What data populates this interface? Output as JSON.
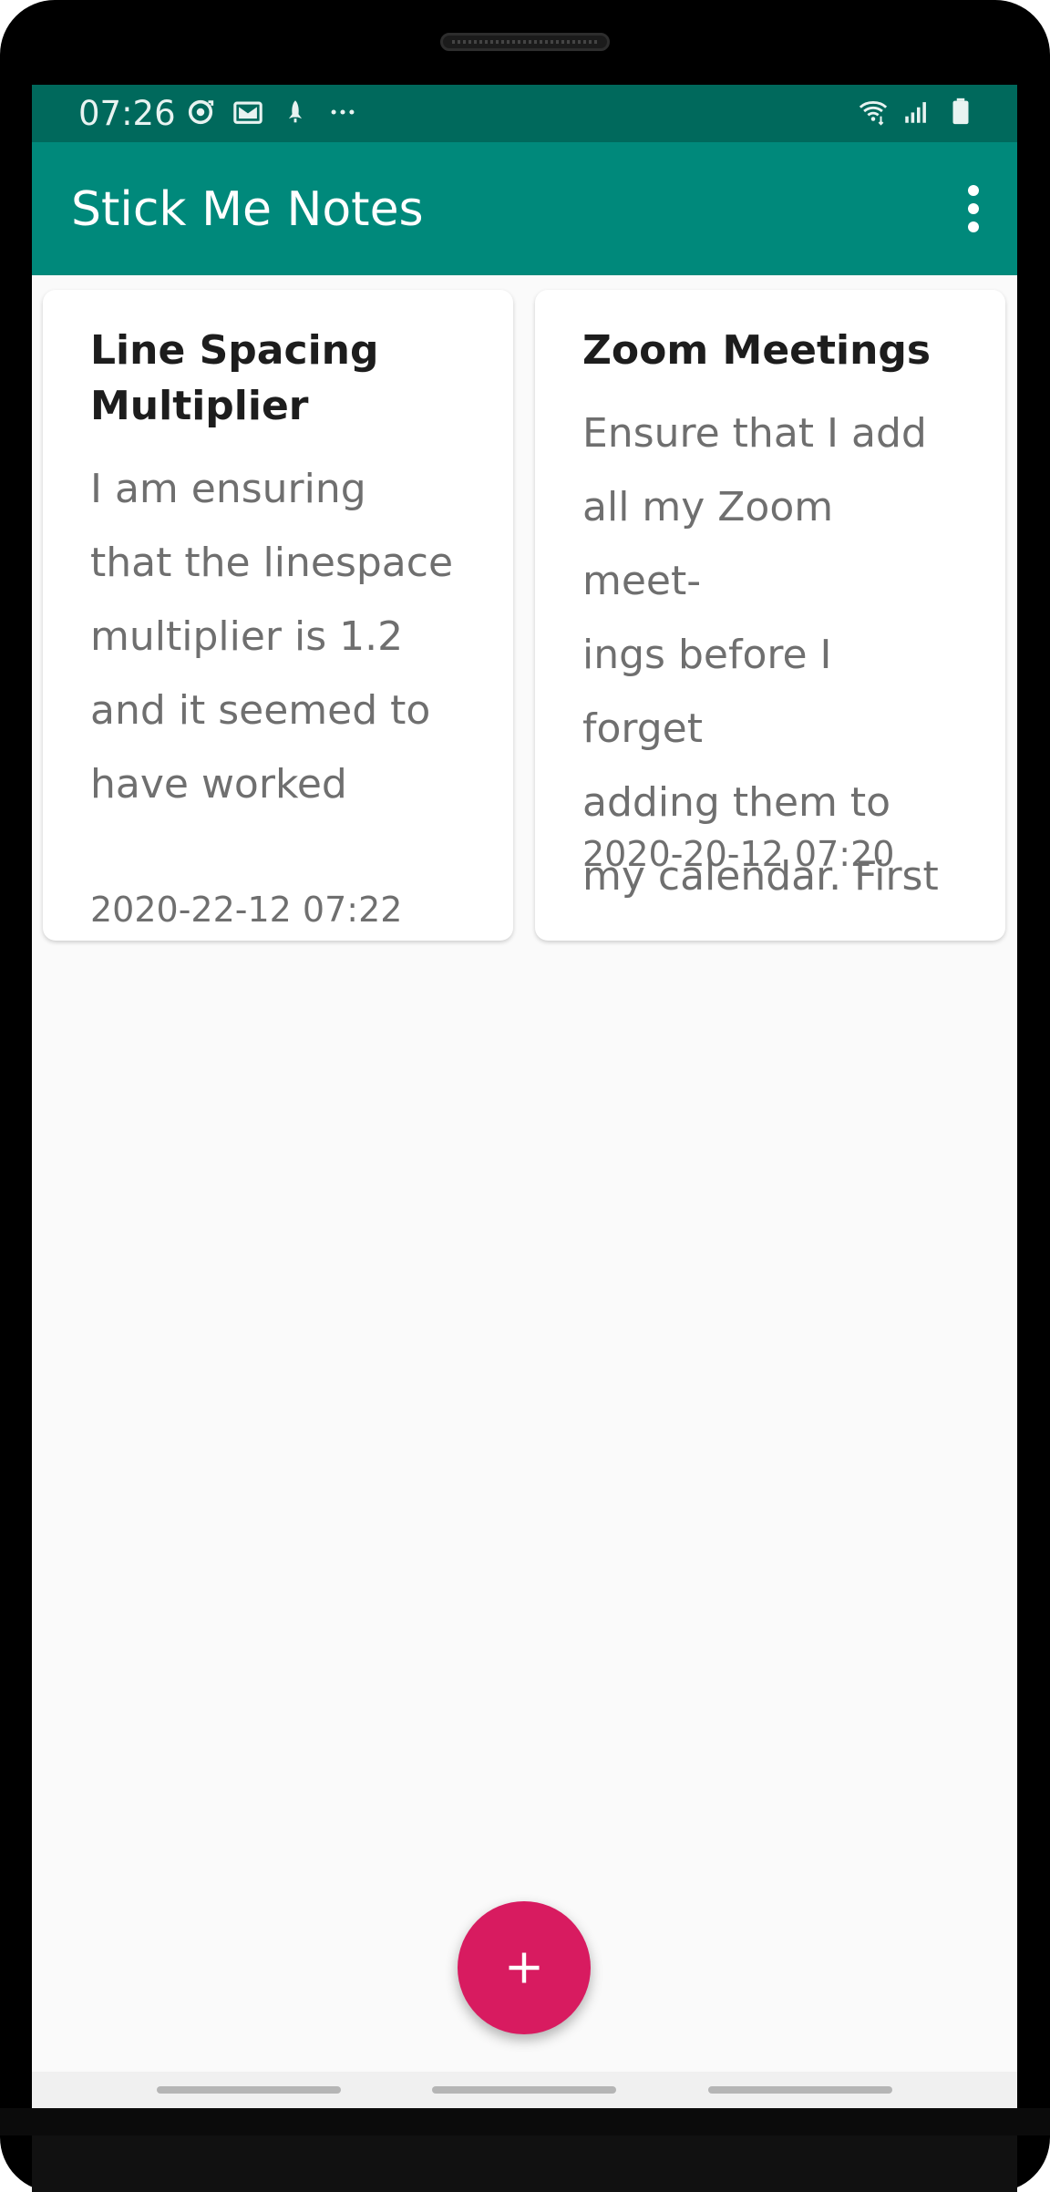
{
  "status_bar": {
    "time": "07:26",
    "left_icons": [
      "sync-icon",
      "gmail-icon",
      "rocket-icon",
      "more-dots-icon"
    ],
    "right_icons": [
      "wifi-icon",
      "signal-icon",
      "battery-icon"
    ]
  },
  "app_bar": {
    "title": "Stick Me Notes",
    "overflow_icon": "more-vert-icon"
  },
  "notes": [
    {
      "title": "Line Spacing\nMultiplier",
      "body": "I am ensuring\nthat the linespace\nmultiplier is 1.2\nand it seemed to\nhave worked",
      "date": "2020-22-12 07:22"
    },
    {
      "title": "Zoom Meetings",
      "body": "Ensure that I add\nall my Zoom meet-\nings before I forget\nadding them to\nmy calendar. First",
      "date": "2020-20-12 07:20"
    }
  ],
  "fab": {
    "icon": "plus-icon",
    "label": "+"
  },
  "colors": {
    "status_bar": "#00695c",
    "app_bar": "#00897b",
    "fab": "#d81b60",
    "background": "#fafafa"
  }
}
